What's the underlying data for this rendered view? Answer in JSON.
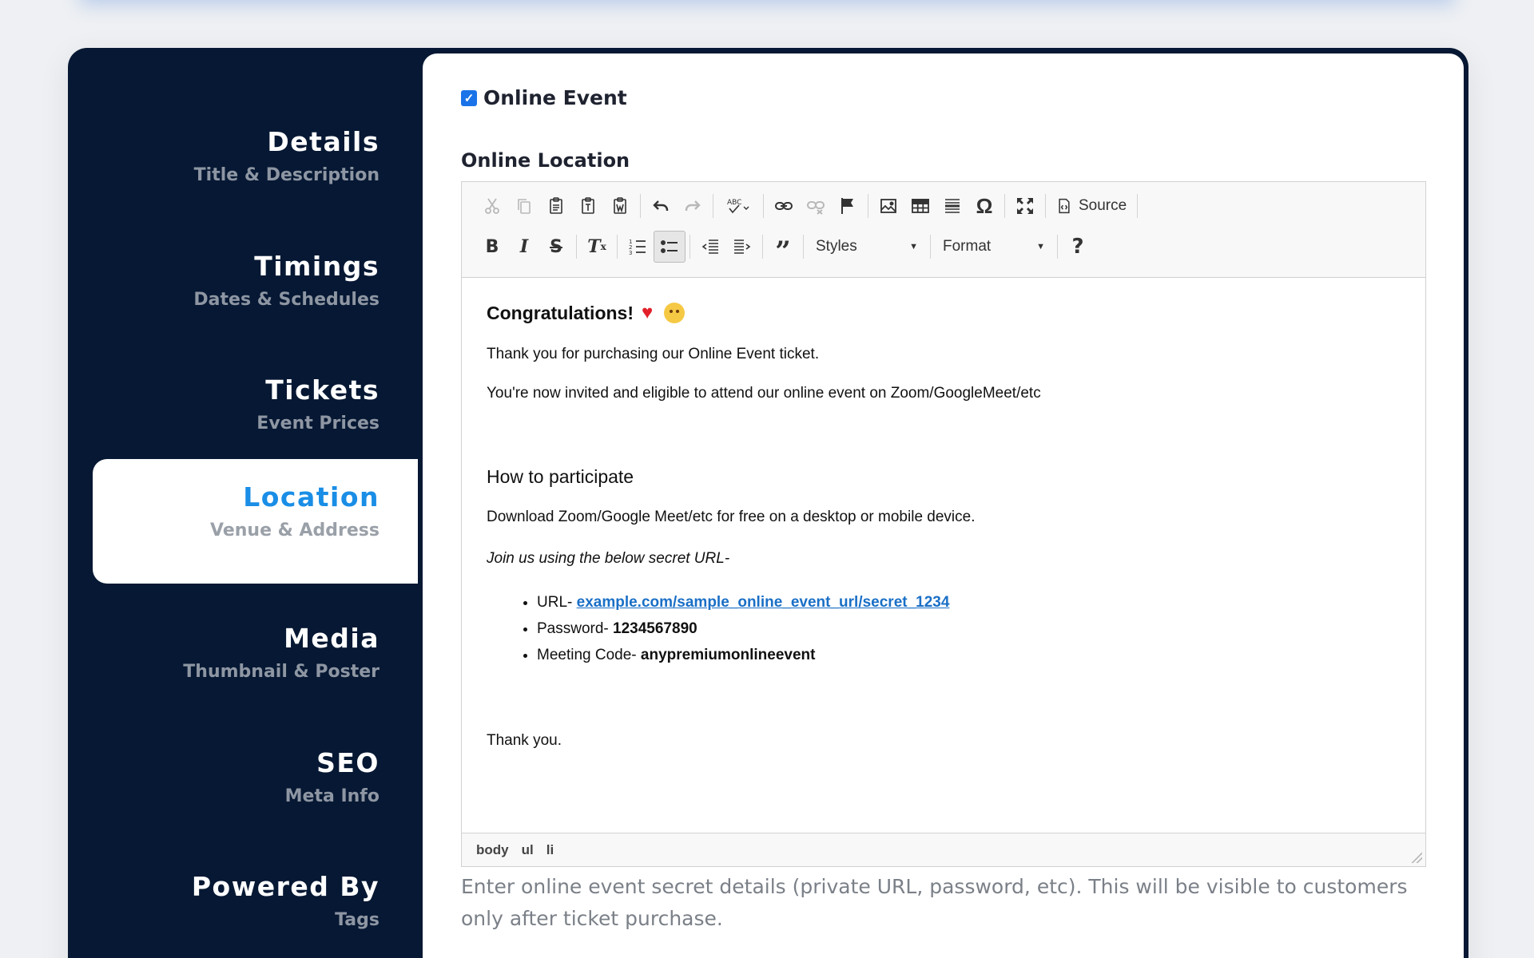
{
  "sidebar": {
    "items": [
      {
        "title": "Details",
        "subtitle": "Title & Description"
      },
      {
        "title": "Timings",
        "subtitle": "Dates & Schedules"
      },
      {
        "title": "Tickets",
        "subtitle": "Event Prices"
      },
      {
        "title": "Location",
        "subtitle": "Venue & Address"
      },
      {
        "title": "Media",
        "subtitle": "Thumbnail & Poster"
      },
      {
        "title": "SEO",
        "subtitle": "Meta Info"
      },
      {
        "title": "Powered By",
        "subtitle": "Tags"
      }
    ],
    "active": "Location"
  },
  "form": {
    "online_event_label": "Online Event",
    "online_event_checked": true,
    "online_location_label": "Online Location",
    "help_text": "Enter online event secret details (private URL, password, etc). This will be visible to customers only after ticket purchase."
  },
  "toolbar": {
    "row1": [
      "cut-icon",
      "copy-icon",
      "paste-icon",
      "paste-text-icon",
      "paste-word-icon",
      "undo-icon",
      "redo-icon",
      "spellcheck-icon",
      "link-icon",
      "unlink-icon",
      "anchor-flag-icon",
      "image-icon",
      "table-icon",
      "horizontal-line-icon",
      "special-char-icon",
      "maximize-icon"
    ],
    "source_label": "Source",
    "row2": [
      "bold-icon",
      "italic-icon",
      "strike-icon",
      "remove-format-icon",
      "numbered-list-icon",
      "bulleted-list-icon",
      "outdent-icon",
      "indent-icon",
      "blockquote-icon"
    ],
    "styles_label": "Styles",
    "format_label": "Format",
    "help_label": "?"
  },
  "content": {
    "heading": "Congratulations!",
    "para1": "Thank you for purchasing our Online Event ticket.",
    "para2": "You're now invited and eligible to attend our online event on Zoom/GoogleMeet/etc",
    "heading2": "How to participate",
    "para3": "Download Zoom/Google Meet/etc for free on a desktop or mobile device.",
    "para4": "Join us using the below secret URL-",
    "list": {
      "url_label": "URL- ",
      "url": "example.com/sample_online_event_url/secret_1234",
      "password_label": "Password- ",
      "password": "1234567890",
      "code_label": "Meeting Code- ",
      "code": "anypremiumonlineevent"
    },
    "closing": "Thank you."
  },
  "statusbar": {
    "path": [
      "body",
      "ul",
      "li"
    ]
  },
  "colors": {
    "sidebar_bg": "#061833",
    "active_title": "#1a8ee6",
    "link": "#1a6fc6",
    "checkbox": "#1a73e8"
  }
}
